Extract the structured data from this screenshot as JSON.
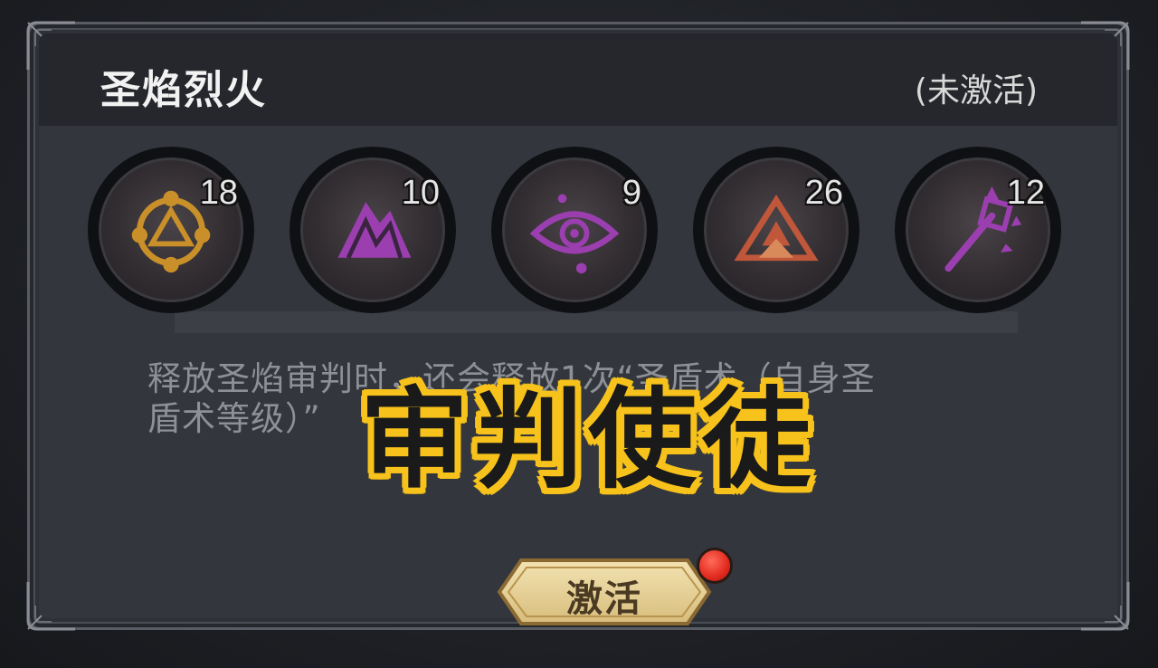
{
  "panel": {
    "title": "圣焰烈火",
    "status": "(未激活)"
  },
  "runes": [
    {
      "icon": "gold-circle-rune-icon",
      "count": "18",
      "color": "#c9902a"
    },
    {
      "icon": "purple-mountain-rune-icon",
      "count": "10",
      "color": "#9b3fb0"
    },
    {
      "icon": "purple-eye-rune-icon",
      "count": "9",
      "color": "#9b3fb0"
    },
    {
      "icon": "red-pyramid-rune-icon",
      "count": "26",
      "color": "#c0573a"
    },
    {
      "icon": "purple-staff-rune-icon",
      "count": "12",
      "color": "#9b3fb0"
    }
  ],
  "description": {
    "line1": "释放圣焰审判时，还会释放1次“圣盾术（自身圣",
    "line2": "盾术等级）”"
  },
  "overlay_caption": "审判使徒",
  "activate_button": {
    "label": "激活",
    "has_notification": true
  },
  "colors": {
    "overlay_stroke": "#f7c21b",
    "badge": "#e22a1e",
    "button_gold": "#e9d59c"
  }
}
